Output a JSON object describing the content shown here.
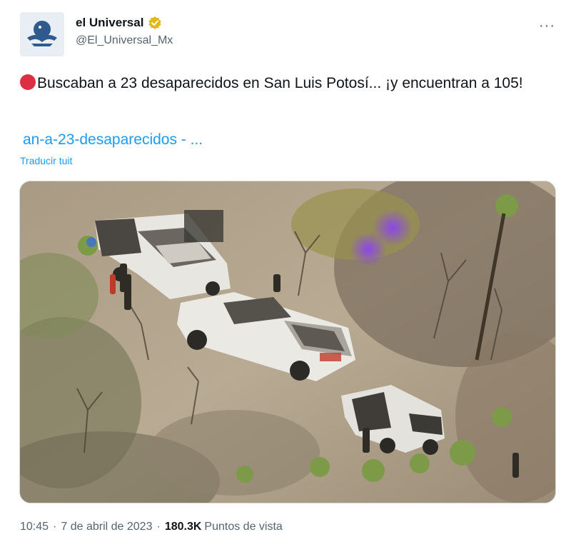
{
  "account": {
    "display_name": "el Universal",
    "handle": "@El_Universal_Mx",
    "avatar_icon": "eagle-logo-icon",
    "verified_color": "#e2b719"
  },
  "menu": {
    "more_label": "···"
  },
  "tweet": {
    "emoji": "red-circle-icon",
    "text": "Buscaban a 23 desaparecidos en San Luis Potosí... ¡y encuentran a 105!",
    "link_text": "an-a-23-desaparecidos - ...",
    "translate_label": "Traducir tuit"
  },
  "media": {
    "icon": "photo-trucks-aerial",
    "description_colors": {
      "ground": "#b3a58e",
      "vegetation": "#6e7a4a",
      "trucks": "#e6e4df",
      "smoke": "#8f52e8"
    }
  },
  "meta": {
    "time": "10:45",
    "separator": "·",
    "date": "7 de abril de 2023",
    "views_count": "180.3K",
    "views_label": "Puntos de vista"
  },
  "colors": {
    "link": "#1d9bf0",
    "secondary_text": "#536471",
    "primary_text": "#0f1419"
  }
}
